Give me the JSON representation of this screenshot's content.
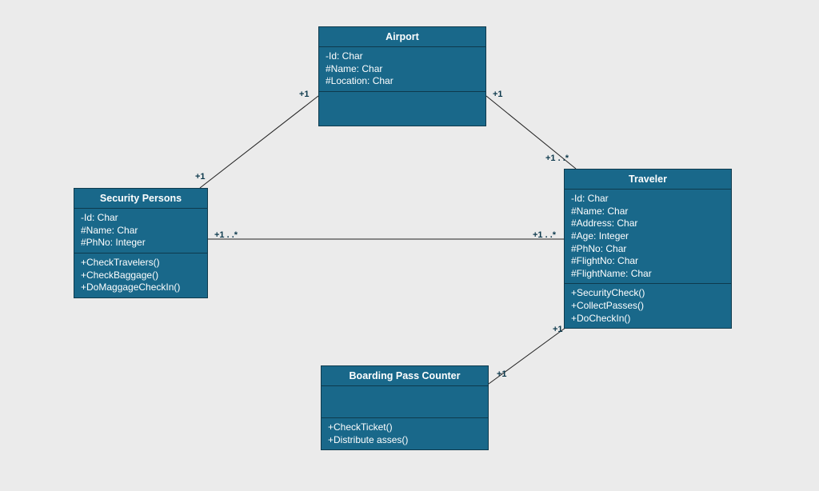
{
  "classes": {
    "airport": {
      "title": "Airport",
      "attributes": [
        "-Id: Char",
        "#Name: Char",
        "#Location: Char"
      ],
      "methods": []
    },
    "security": {
      "title": "Security Persons",
      "attributes": [
        "-Id: Char",
        "#Name: Char",
        "#PhNo: Integer"
      ],
      "methods": [
        "+CheckTravelers()",
        "+CheckBaggage()",
        "+DoMaggageCheckIn()"
      ]
    },
    "traveler": {
      "title": "Traveler",
      "attributes": [
        "-Id: Char",
        "#Name: Char",
        "#Address: Char",
        "#Age: Integer",
        "#PhNo: Char",
        "#FlightNo: Char",
        "#FlightName: Char"
      ],
      "methods": [
        "+SecurityCheck()",
        "+CollectPasses()",
        "+DoCheckIn()"
      ]
    },
    "boarding": {
      "title": "Boarding Pass Counter",
      "attributes": [],
      "methods": [
        "+CheckTicket()",
        "+Distribute asses()"
      ]
    }
  },
  "mult": {
    "airport_to_security_top": "+1",
    "airport_to_security_bot": "+1",
    "airport_to_traveler_top": "+1",
    "airport_to_traveler_bot": "+1 . .*",
    "security_to_traveler_left": "+1 . .*",
    "security_to_traveler_right": "+1 . .*",
    "traveler_to_boarding_top": "+1",
    "traveler_to_boarding_bot": "+1"
  }
}
